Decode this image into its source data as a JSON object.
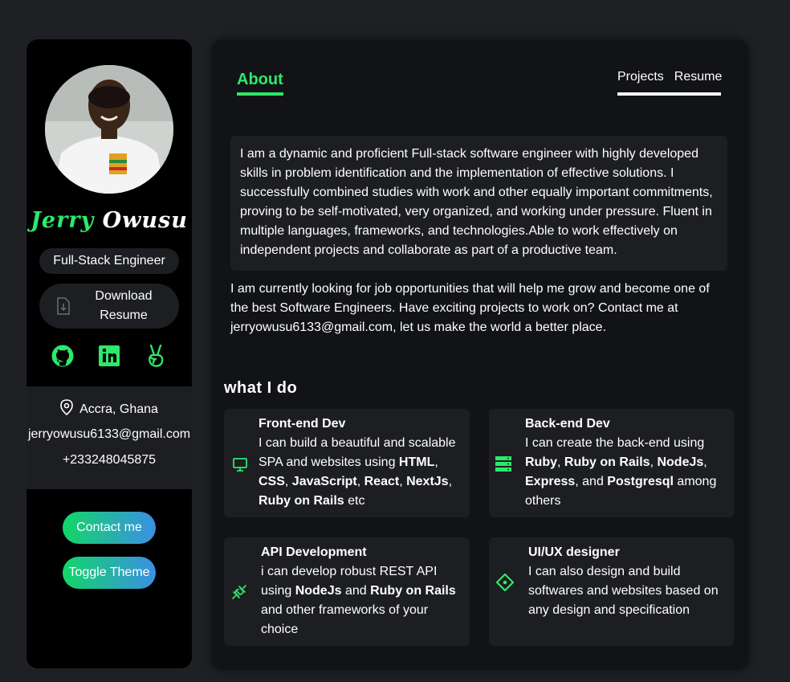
{
  "profile": {
    "first_name": "Jerry",
    "last_name": "Owusu",
    "role": "Full-Stack Engineer",
    "download_label": "Download Resume",
    "location": "Accra, Ghana",
    "email": "jerryowusu6133@gmail.com",
    "phone": "+233248045875",
    "contact_label": "Contact me",
    "theme_label": "Toggle Theme",
    "socials": [
      "github-icon",
      "linkedin-icon",
      "angellist-icon"
    ]
  },
  "nav": {
    "active_tab": "About",
    "tabs": [
      "Projects",
      "Resume"
    ]
  },
  "about": {
    "paragraph1": "I am a dynamic and proficient Full-stack software engineer with highly developed skills in problem identification and the implementation of effective solutions. I successfully combined studies with work and other equally important commitments, proving to be self-motivated, very organized, and working under pressure. Fluent in multiple languages, frameworks, and technologies.Able to work effectively on independent projects and collaborate as part of a productive team.",
    "paragraph2": "I am currently looking for job opportunities that will help me grow and become one of the best Software Engineers. Have exciting projects to work on? Contact me at jerryowusu6133@gmail.com, let us make the world a better place."
  },
  "services": {
    "heading": "what I do",
    "items": [
      {
        "title": "Front-end Dev",
        "icon": "monitor-icon",
        "parts": [
          {
            "t": "I can build a beautiful and scalable SPA and websites using ",
            "b": false
          },
          {
            "t": "HTML",
            "b": true
          },
          {
            "t": ", ",
            "b": false
          },
          {
            "t": "CSS",
            "b": true
          },
          {
            "t": ", ",
            "b": false
          },
          {
            "t": "JavaScript",
            "b": true
          },
          {
            "t": ", ",
            "b": false
          },
          {
            "t": "React",
            "b": true
          },
          {
            "t": ", ",
            "b": false
          },
          {
            "t": "NextJs",
            "b": true
          },
          {
            "t": ", ",
            "b": false
          },
          {
            "t": "Ruby on Rails",
            "b": true
          },
          {
            "t": " etc",
            "b": false
          }
        ]
      },
      {
        "title": "Back-end Dev",
        "icon": "server-icon",
        "parts": [
          {
            "t": "I can create the back-end using ",
            "b": false
          },
          {
            "t": "Ruby",
            "b": true
          },
          {
            "t": ", ",
            "b": false
          },
          {
            "t": "Ruby on Rails",
            "b": true
          },
          {
            "t": ", ",
            "b": false
          },
          {
            "t": "NodeJs",
            "b": true
          },
          {
            "t": ", ",
            "b": false
          },
          {
            "t": "Express",
            "b": true
          },
          {
            "t": ", and ",
            "b": false
          },
          {
            "t": "Postgresql",
            "b": true
          },
          {
            "t": " among others",
            "b": false
          }
        ]
      },
      {
        "title": "API Development",
        "icon": "plug-icon",
        "parts": [
          {
            "t": "i can develop robust REST API using ",
            "b": false
          },
          {
            "t": "NodeJs",
            "b": true
          },
          {
            "t": " and ",
            "b": false
          },
          {
            "t": "Ruby on Rails",
            "b": true
          },
          {
            "t": " and other frameworks of your choice",
            "b": false
          }
        ]
      },
      {
        "title": "UI/UX designer",
        "icon": "design-icon",
        "parts": [
          {
            "t": "I can also design and build softwares and websites based on any design and specification",
            "b": false
          }
        ]
      }
    ]
  },
  "colors": {
    "accent": "#2ee86a",
    "gradient_start": "#12d668",
    "gradient_end": "#3b8fe4",
    "card_bg": "#1d1e22"
  }
}
